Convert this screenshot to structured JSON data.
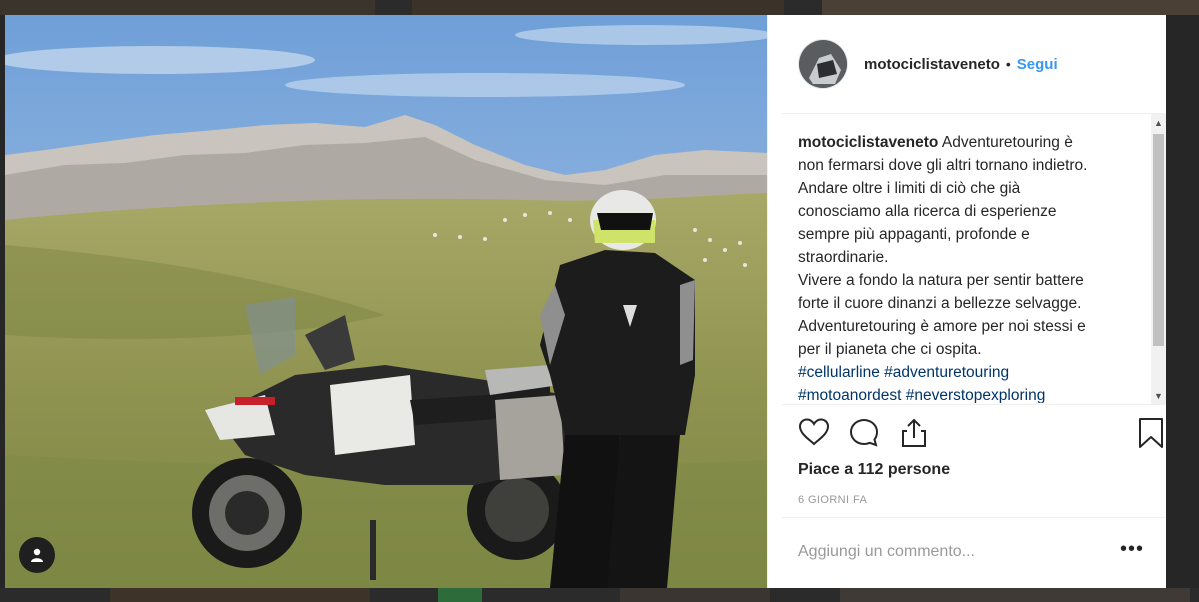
{
  "post": {
    "username": "motociclistaveneto",
    "separator": "•",
    "follow_label": "Segui",
    "caption_lines": [
      "Adventuretouring è",
      "non fermarsi dove gli altri tornano indietro.",
      "Andare oltre i limiti di ciò che già",
      "conosciamo alla ricerca di esperienze",
      "sempre più appaganti, profonde e",
      "straordinarie.",
      "Vivere a fondo la natura per sentir battere",
      "forte il cuore dinanzi a bellezze selvagge.",
      "Adventuretouring è amore per noi stessi e",
      "per il pianeta che ci ospita."
    ],
    "hashtags_line1": [
      "#cellularline",
      "#adventuretouring"
    ],
    "hashtags_line2": [
      "#motoanordest",
      "#neverstopexploring"
    ],
    "likes": "Piace a 112 persone",
    "timestamp": "6 GIORNI FA",
    "comment_placeholder": "Aggiungi un commento...",
    "more_label": "•••"
  },
  "icons": {
    "like": "heart-icon",
    "comment": "comment-bubble-icon",
    "share": "share-icon",
    "save": "bookmark-icon",
    "user_tag": "user-icon"
  },
  "colors": {
    "follow": "#3897f0",
    "hashtag": "#003569",
    "text": "#262626",
    "muted": "#999999"
  }
}
